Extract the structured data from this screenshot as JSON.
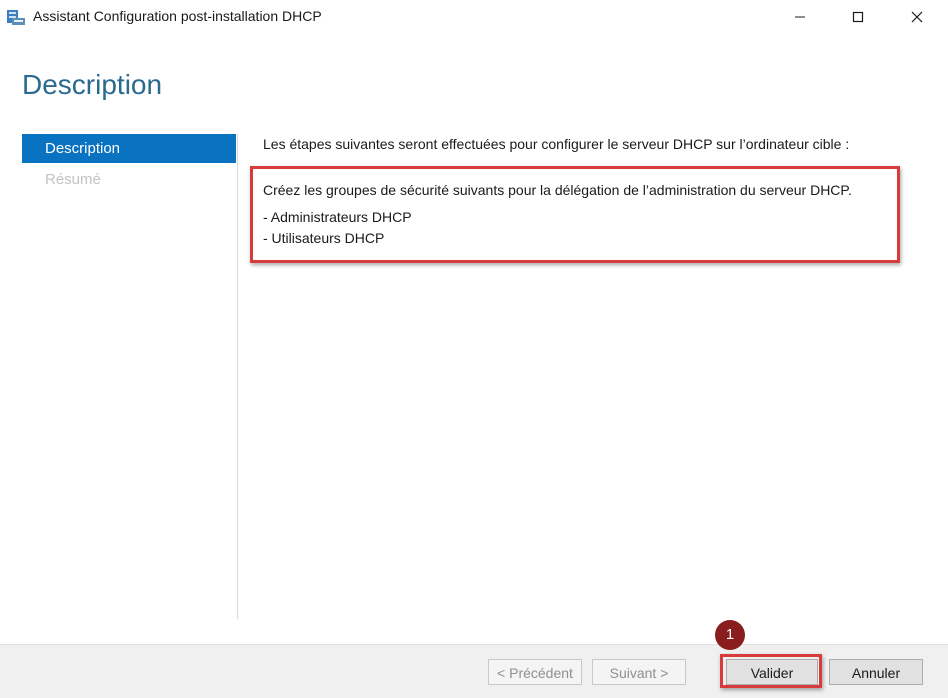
{
  "window": {
    "title": "Assistant Configuration post-installation DHCP",
    "controls": {
      "minimize": "minimize-icon",
      "maximize": "maximize-icon",
      "close": "close-icon"
    }
  },
  "page": {
    "title": "Description"
  },
  "nav": {
    "items": [
      {
        "label": "Description",
        "state": "active"
      },
      {
        "label": "Résumé",
        "state": "disabled"
      }
    ]
  },
  "main": {
    "intro": "Les étapes suivantes seront effectuées pour configurer le serveur DHCP sur l’ordinateur cible :",
    "body_heading": "Créez les groupes de sécurité suivants pour la délégation de l’administration du serveur DHCP.",
    "groups": [
      "- Administrateurs DHCP",
      "- Utilisateurs DHCP"
    ]
  },
  "footer": {
    "previous_label": "< Précédent",
    "next_label": "Suivant >",
    "validate_label": "Valider",
    "cancel_label": "Annuler"
  },
  "annotation": {
    "step_number": "1",
    "highlight_color": "#d83b3b"
  },
  "colors": {
    "accent": "#0a73c1",
    "title": "#2a6a8f"
  }
}
